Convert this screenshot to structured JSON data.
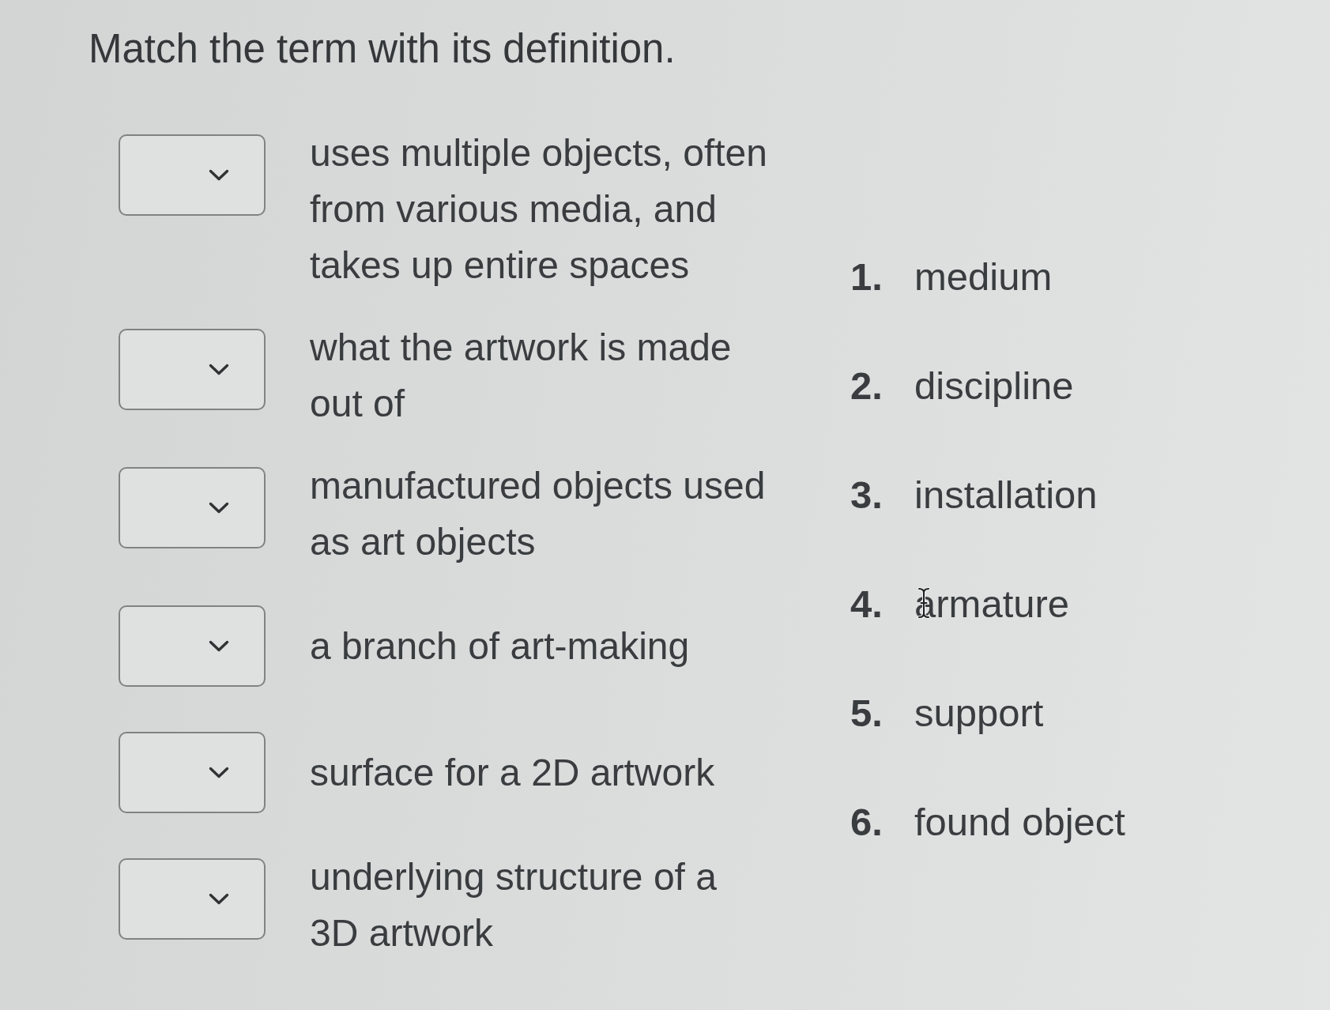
{
  "title": "Match the term with its definition.",
  "matches": [
    {
      "definition": "uses multiple objects, often from various media, and takes up entire spaces"
    },
    {
      "definition": "what the artwork is made out of"
    },
    {
      "definition": "manufactured objects used as art objects"
    },
    {
      "definition": "a branch of art-making"
    },
    {
      "definition": "surface for a 2D artwork"
    },
    {
      "definition": "underlying structure of a 3D artwork"
    }
  ],
  "terms": [
    {
      "number": "1.",
      "label": "medium",
      "hovered": false
    },
    {
      "number": "2.",
      "label": "discipline",
      "hovered": false
    },
    {
      "number": "3.",
      "label": "installation",
      "hovered": false
    },
    {
      "number": "4.",
      "label": "armature",
      "hovered": true
    },
    {
      "number": "5.",
      "label": "support",
      "hovered": false
    },
    {
      "number": "6.",
      "label": "found object",
      "hovered": false
    }
  ]
}
